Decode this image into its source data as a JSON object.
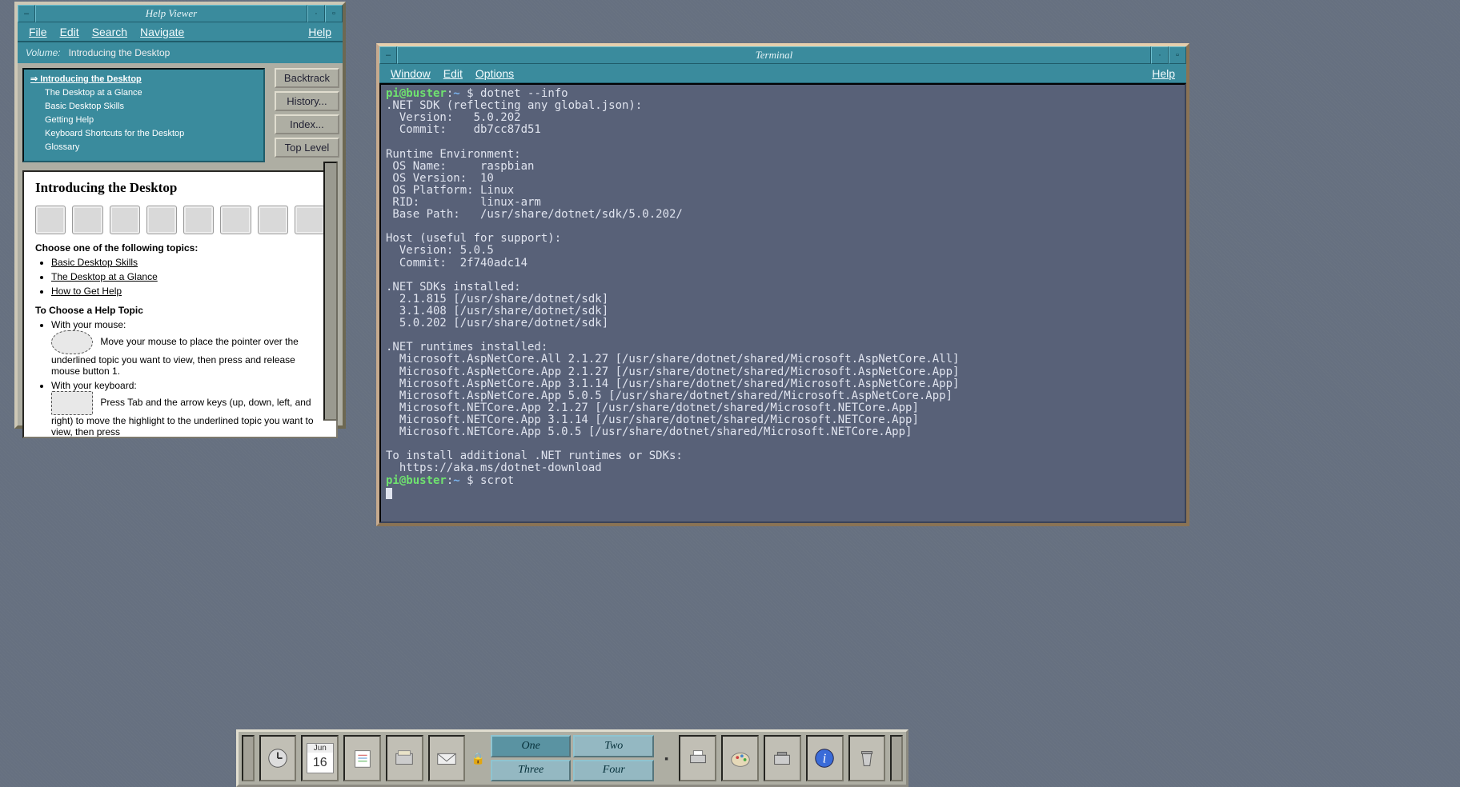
{
  "help_viewer": {
    "title": "Help Viewer",
    "menus": {
      "file": "File",
      "edit": "Edit",
      "search": "Search",
      "navigate": "Navigate",
      "help": "Help"
    },
    "volume_label": "Volume:",
    "volume_value": "Introducing the Desktop",
    "tree": {
      "root": "Introducing the Desktop",
      "children": [
        "The Desktop at a Glance",
        "Basic Desktop Skills",
        "Getting Help",
        "Keyboard Shortcuts for the Desktop",
        "Glossary"
      ]
    },
    "buttons": {
      "backtrack": "Backtrack",
      "history": "History...",
      "index": "Index...",
      "top": "Top Level"
    },
    "doc": {
      "heading": "Introducing the Desktop",
      "choose": "Choose one of the following topics:",
      "links": [
        "Basic Desktop Skills",
        "The Desktop at a Glance",
        "How to Get Help"
      ],
      "howto": "To Choose a Help Topic",
      "mouse_label": "With your mouse:",
      "mouse_text": "Move your mouse to place the pointer over the underlined topic you want to view, then press and release mouse button 1.",
      "kbd_label": "With your keyboard:",
      "kbd_text": "Press Tab and the arrow keys (up, down, left, and right) to move the highlight to the underlined topic you want to view, then press"
    }
  },
  "terminal": {
    "title": "Terminal",
    "menus": {
      "window": "Window",
      "edit": "Edit",
      "options": "Options",
      "help": "Help"
    },
    "prompt": {
      "user": "pi",
      "host": "buster",
      "path": "~",
      "symbol": "$"
    },
    "cmd1": "dotnet --info",
    "out": [
      ".NET SDK (reflecting any global.json):",
      "  Version:   5.0.202",
      "  Commit:    db7cc87d51",
      "",
      "Runtime Environment:",
      " OS Name:     raspbian",
      " OS Version:  10",
      " OS Platform: Linux",
      " RID:         linux-arm",
      " Base Path:   /usr/share/dotnet/sdk/5.0.202/",
      "",
      "Host (useful for support):",
      "  Version: 5.0.5",
      "  Commit:  2f740adc14",
      "",
      ".NET SDKs installed:",
      "  2.1.815 [/usr/share/dotnet/sdk]",
      "  3.1.408 [/usr/share/dotnet/sdk]",
      "  5.0.202 [/usr/share/dotnet/sdk]",
      "",
      ".NET runtimes installed:",
      "  Microsoft.AspNetCore.All 2.1.27 [/usr/share/dotnet/shared/Microsoft.AspNetCore.All]",
      "  Microsoft.AspNetCore.App 2.1.27 [/usr/share/dotnet/shared/Microsoft.AspNetCore.App]",
      "  Microsoft.AspNetCore.App 3.1.14 [/usr/share/dotnet/shared/Microsoft.AspNetCore.App]",
      "  Microsoft.AspNetCore.App 5.0.5 [/usr/share/dotnet/shared/Microsoft.AspNetCore.App]",
      "  Microsoft.NETCore.App 2.1.27 [/usr/share/dotnet/shared/Microsoft.NETCore.App]",
      "  Microsoft.NETCore.App 3.1.14 [/usr/share/dotnet/shared/Microsoft.NETCore.App]",
      "  Microsoft.NETCore.App 5.0.5 [/usr/share/dotnet/shared/Microsoft.NETCore.App]",
      "",
      "To install additional .NET runtimes or SDKs:",
      "  https://aka.ms/dotnet-download"
    ],
    "cmd2": "scrot"
  },
  "panel": {
    "date_month": "Jun",
    "date_day": "16",
    "workspaces": [
      "One",
      "Two",
      "Three",
      "Four"
    ]
  }
}
